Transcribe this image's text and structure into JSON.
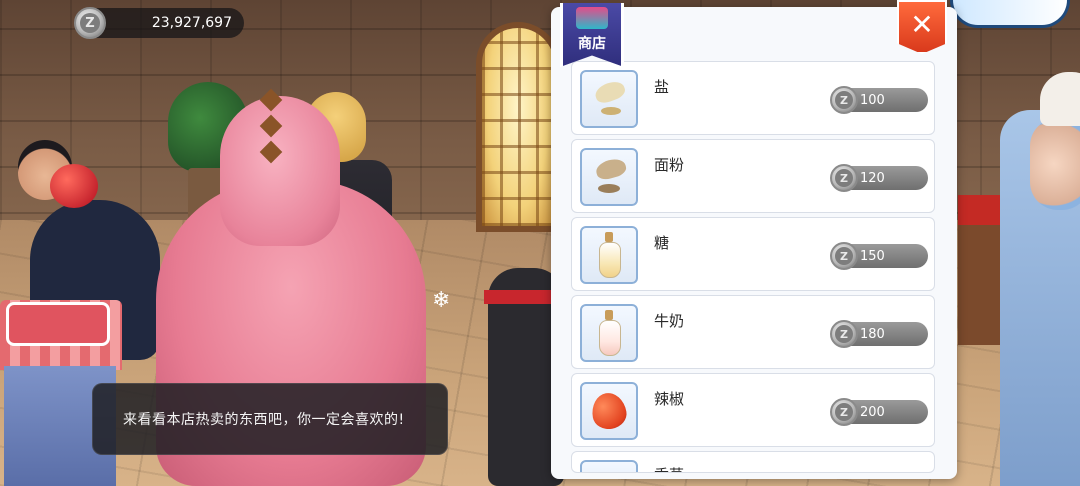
{
  "hud": {
    "currency_value": "23,927,697",
    "coin_symbol": "Z"
  },
  "dialog": {
    "text": "来看看本店热卖的东西吧，你一定会喜欢的!"
  },
  "shop": {
    "title": "商店",
    "close_symbol": "✕",
    "items": [
      {
        "name": "盐",
        "price": "100",
        "icon": "salt-icon"
      },
      {
        "name": "面粉",
        "price": "120",
        "icon": "flour-icon"
      },
      {
        "name": "糖",
        "price": "150",
        "icon": "sugar-bottle-icon"
      },
      {
        "name": "牛奶",
        "price": "180",
        "icon": "milk-bottle-icon"
      },
      {
        "name": "辣椒",
        "price": "200",
        "icon": "chili-pepper-icon"
      },
      {
        "name": "香草",
        "price": "",
        "icon": "herb-icon"
      }
    ]
  },
  "colors": {
    "panel_bg": "#f7f9fc",
    "price_pill": "#7f7f7f",
    "close_button": "#e44a26",
    "shop_tag": "#3a3990"
  }
}
